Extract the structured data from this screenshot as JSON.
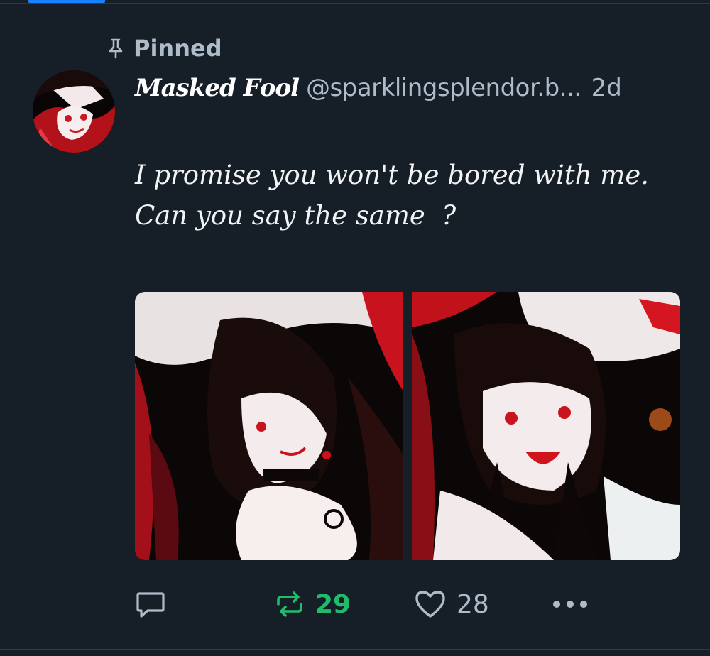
{
  "pinned": {
    "label": "Pinned",
    "icon": "pin-icon"
  },
  "author": {
    "display_name": "𝑴𝒂𝒔𝒌𝒆𝒅 𝑭𝒐𝒐𝒍",
    "handle": "@sparklingsplendor.b...",
    "timestamp": "2d",
    "avatar_icon": "avatar"
  },
  "post": {
    "lines": [
      "I promise you won't be bored with me.",
      "Can you say the same  ?"
    ],
    "images": [
      "image-1",
      "image-2"
    ]
  },
  "actions": {
    "reply_icon": "reply-icon",
    "repost_icon": "repost-icon",
    "repost_count": "29",
    "like_icon": "heart-icon",
    "like_count": "28",
    "more_icon": "more-icon"
  },
  "colors": {
    "background": "#161e27",
    "muted_text": "#aebbc9",
    "repost_active": "#20bc6b",
    "accent_tab": "#1a82ff"
  }
}
